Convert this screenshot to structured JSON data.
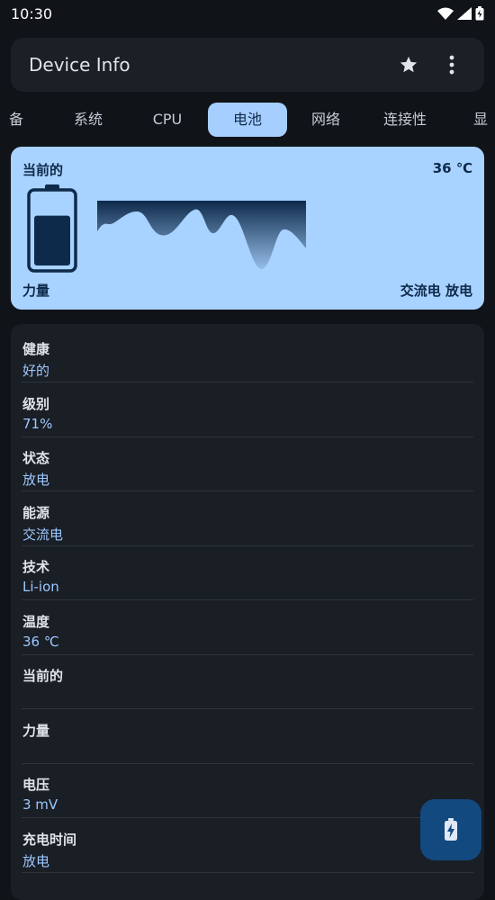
{
  "status_bar": {
    "time": "10:30",
    "icons": [
      "wifi-icon",
      "signal-icon",
      "battery-charging-icon"
    ]
  },
  "app_bar": {
    "title": "Device Info",
    "favorite_icon": "star-icon",
    "menu_icon": "more-vert-icon"
  },
  "tabs": [
    {
      "label": "备",
      "active": false
    },
    {
      "label": "系统",
      "active": false
    },
    {
      "label": "CPU",
      "active": false
    },
    {
      "label": "电池",
      "active": true
    },
    {
      "label": "网络",
      "active": false
    },
    {
      "label": "连接性",
      "active": false
    },
    {
      "label": "显",
      "active": false
    }
  ],
  "battery_card": {
    "current_label": "当前的",
    "temperature": "36 ℃",
    "power_label": "力量",
    "source_status": "交流电 放电",
    "battery_level_fraction": 0.71,
    "colors": {
      "card": "#a8d2ff",
      "ink": "#0e2a4a"
    }
  },
  "info_rows": [
    {
      "label": "健康",
      "value": "好的"
    },
    {
      "label": "级别",
      "value": "71%"
    },
    {
      "label": "状态",
      "value": "放电"
    },
    {
      "label": "能源",
      "value": "交流电"
    },
    {
      "label": "技术",
      "value": "Li-ion"
    },
    {
      "label": "温度",
      "value": "36 ℃"
    },
    {
      "label": "当前的",
      "value": ""
    },
    {
      "label": "力量",
      "value": ""
    },
    {
      "label": "电压",
      "value": "3 mV"
    },
    {
      "label": "充电时间",
      "value": "放电"
    }
  ],
  "fab": {
    "icon": "battery-charging-icon"
  },
  "colors": {
    "background": "#101318",
    "surface": "#1b1f26",
    "accent": "#a6ceff",
    "value_text": "#9cc8ff",
    "fab": "#12497e"
  }
}
